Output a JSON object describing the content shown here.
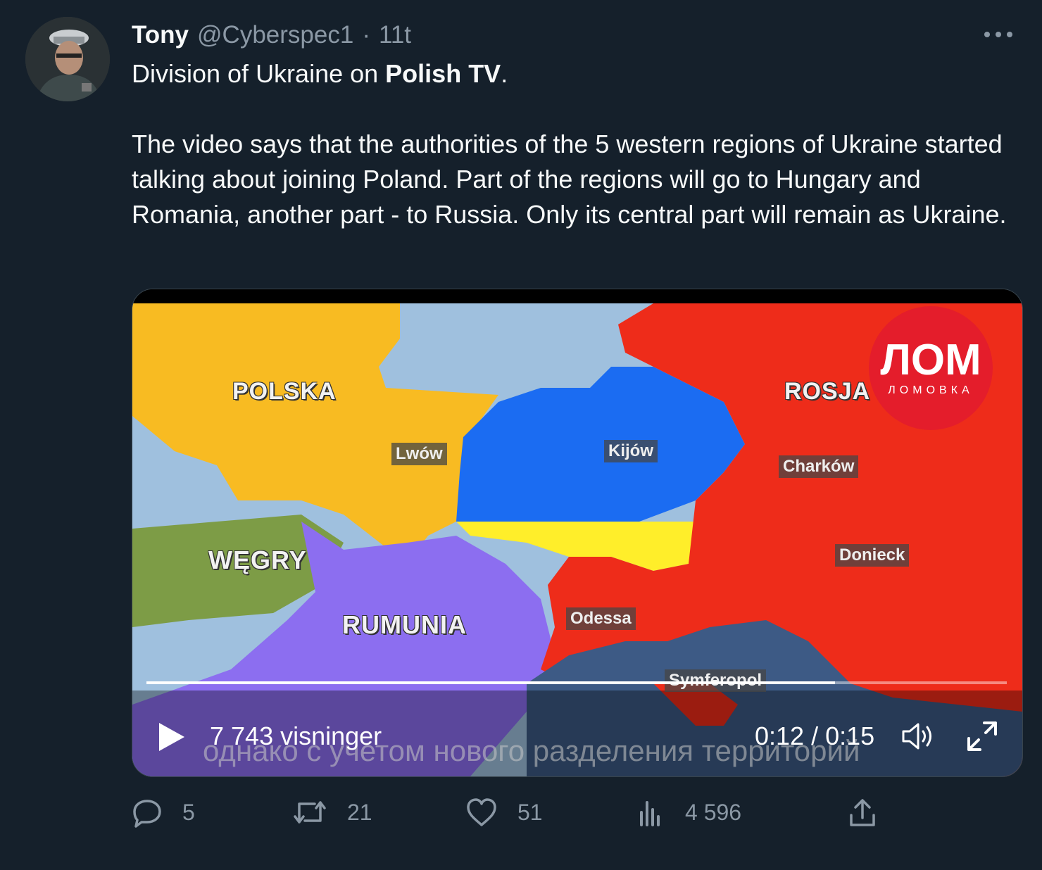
{
  "tweet": {
    "author_name": "Tony",
    "author_handle": "@Cyberspec1",
    "separator": "·",
    "timestamp": "11t",
    "line1_prefix": "Division of Ukraine on ",
    "line1_bold": "Polish TV",
    "line1_suffix": ".",
    "body": "The video says that the authorities of the 5 western regions of Ukraine started talking about joining Poland. Part of the regions will go to Hungary and Romania, another part - to Russia. Only its central part will remain as Ukraine."
  },
  "video": {
    "map_labels": {
      "polska": "POLSKA",
      "rosja": "ROSJA",
      "wegry": "WĘGRY",
      "rumunia": "RUMUNIA"
    },
    "cities": {
      "lwow": "Lwów",
      "kijow": "Kijów",
      "charkow": "Charków",
      "donieck": "Donieck",
      "odessa": "Odessa",
      "symferopol": "Symferopol"
    },
    "logo_big": "ЛОМ",
    "logo_small": "ЛОМОВКА",
    "subtitle": "однако с учетом нового разделения территорий",
    "views": "7 743 visninger",
    "time": "0:12 / 0:15",
    "progress": 0.8
  },
  "actions": {
    "replies": "5",
    "retweets": "21",
    "likes": "51",
    "views": "4 596"
  },
  "icons": {
    "reply": "reply-icon",
    "retweet": "retweet-icon",
    "like": "heart-icon",
    "views": "analytics-icon",
    "share": "share-icon",
    "more": "more-icon",
    "play": "play-icon",
    "volume": "volume-icon",
    "fullscreen": "fullscreen-icon"
  },
  "colors": {
    "background": "#15202b",
    "secondary_text": "#8b98a5",
    "poland": "#f8bb22",
    "russia": "#ee2c1a",
    "ukraine_blue": "#1b6cf2",
    "ukraine_yellow": "#ffee2a",
    "hungary": "#7d9c46",
    "romania": "#8c6ef0",
    "sea": "#9fc0de"
  }
}
